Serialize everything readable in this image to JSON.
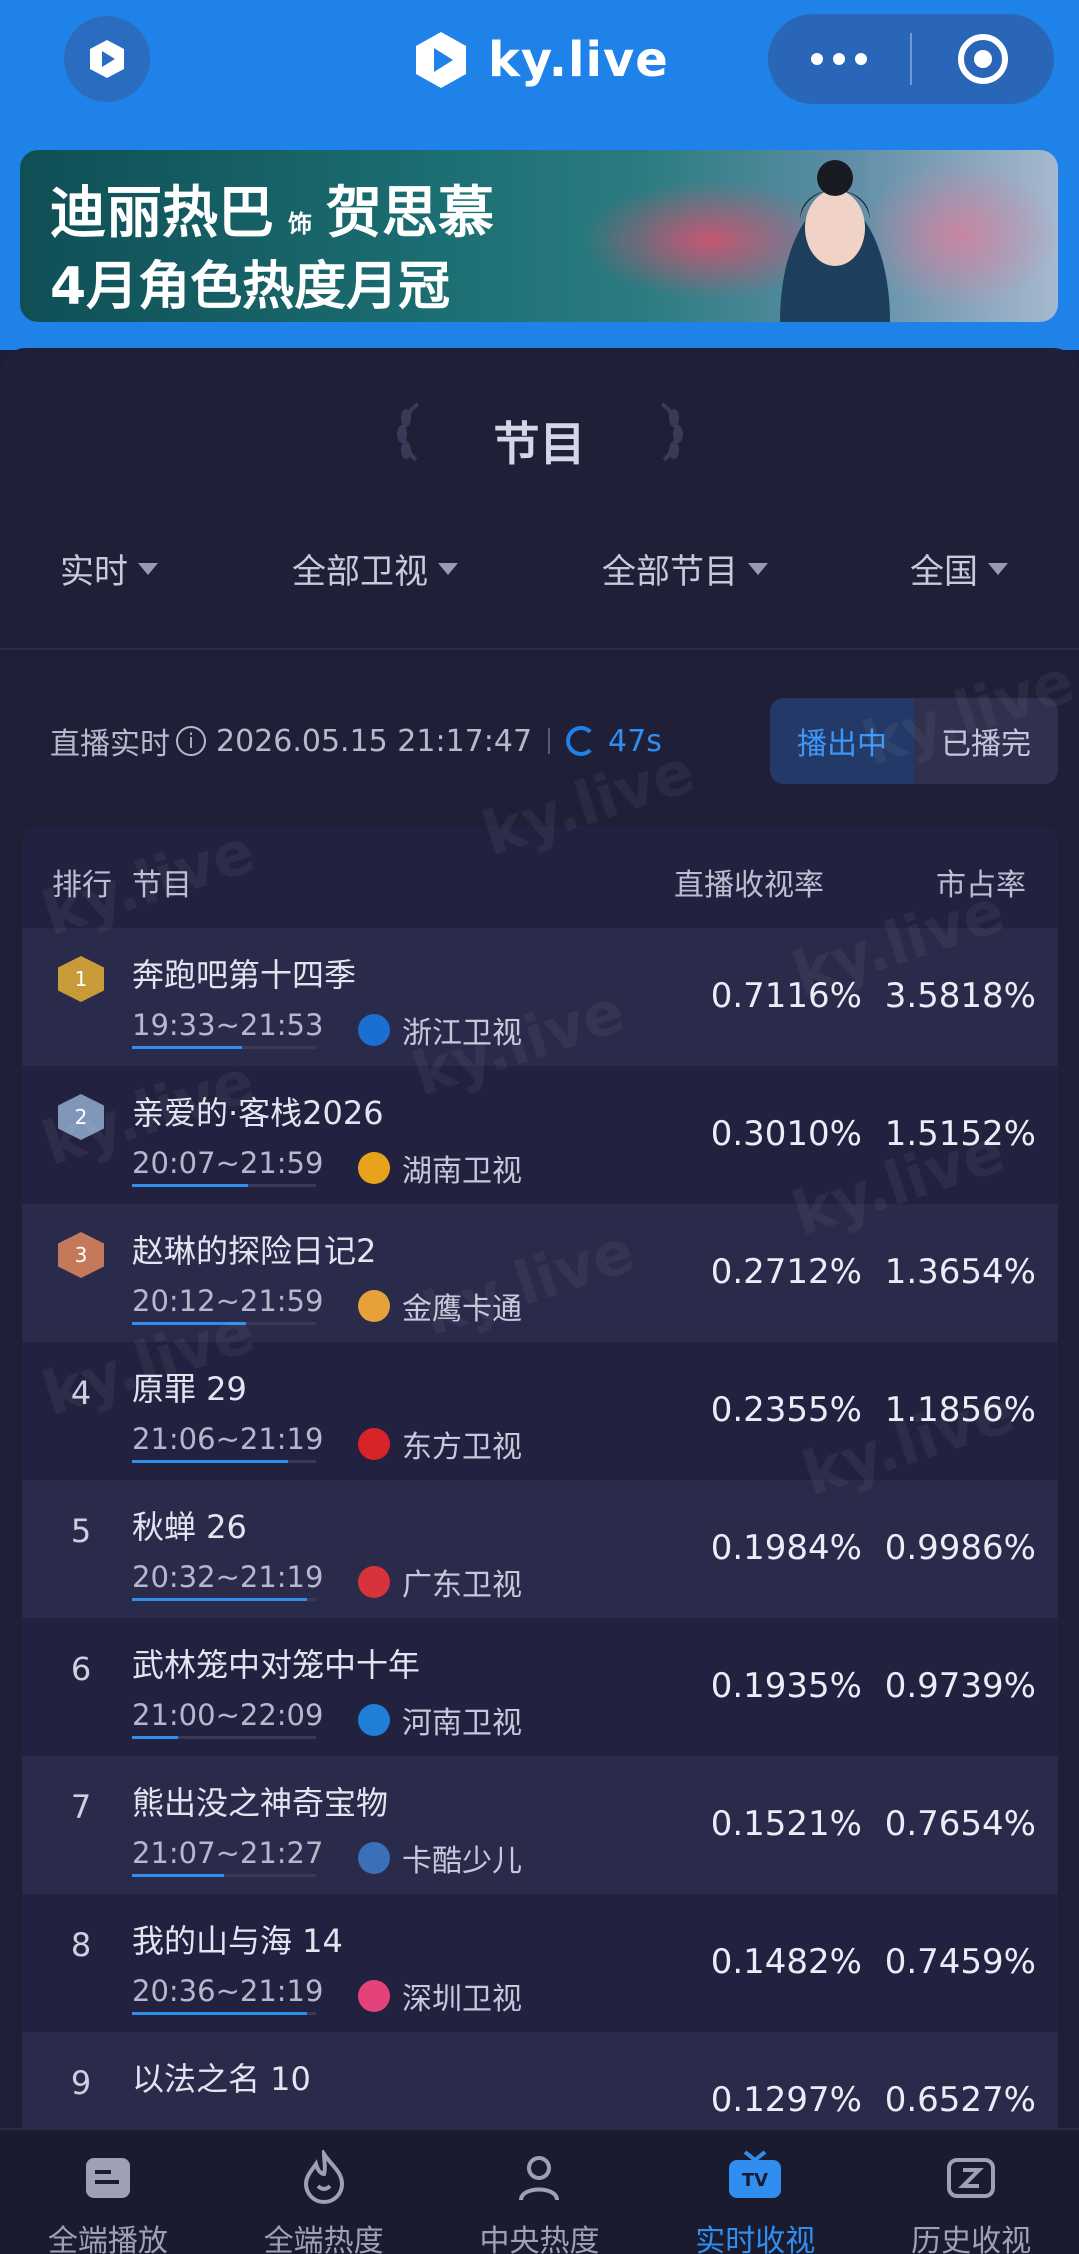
{
  "header": {
    "brand": "ky.live",
    "icons": {
      "app": "ky-logo-icon",
      "more": "more-dots-icon",
      "target": "target-icon"
    }
  },
  "banner": {
    "line1_a": "迪丽热巴",
    "line1_small": "饰",
    "line1_b": "贺思慕",
    "line2": "4月角色热度月冠"
  },
  "section_title": "节目",
  "filters": [
    {
      "label": "实时"
    },
    {
      "label": "全部卫视"
    },
    {
      "label": "全部节目"
    },
    {
      "label": "全国"
    }
  ],
  "status": {
    "label": "直播实时",
    "datetime": "2026.05.15 21:17:47",
    "countdown": "47s"
  },
  "toggle": {
    "on_air": "播出中",
    "finished": "已播完",
    "selected": "播出中"
  },
  "table": {
    "headers": {
      "rank": "排行",
      "program": "节目",
      "rating": "直播收视率",
      "share": "市占率"
    },
    "rows": [
      {
        "rank": "1",
        "name": "奔跑吧第十四季",
        "time": "19:33~21:53",
        "channel": "浙江卫视",
        "rating": "0.7116%",
        "share": "3.5818%",
        "progress": 0.6,
        "logo_color": "#1a6fd1"
      },
      {
        "rank": "2",
        "name": "亲爱的·客栈2026",
        "time": "20:07~21:59",
        "channel": "湖南卫视",
        "rating": "0.3010%",
        "share": "1.5152%",
        "progress": 0.63,
        "logo_color": "#e9a21c"
      },
      {
        "rank": "3",
        "name": "赵琳的探险日记2",
        "time": "20:12~21:59",
        "channel": "金鹰卡通",
        "rating": "0.2712%",
        "share": "1.3654%",
        "progress": 0.62,
        "logo_color": "#e6a23a"
      },
      {
        "rank": "4",
        "name": "原罪 29",
        "time": "21:06~21:19",
        "channel": "东方卫视",
        "rating": "0.2355%",
        "share": "1.1856%",
        "progress": 0.85,
        "logo_color": "#d8232a"
      },
      {
        "rank": "5",
        "name": "秋蝉 26",
        "time": "20:32~21:19",
        "channel": "广东卫视",
        "rating": "0.1984%",
        "share": "0.9986%",
        "progress": 0.95,
        "logo_color": "#d8333a"
      },
      {
        "rank": "6",
        "name": "武林笼中对笼中十年",
        "time": "21:00~22:09",
        "channel": "河南卫视",
        "rating": "0.1935%",
        "share": "0.9739%",
        "progress": 0.25,
        "logo_color": "#1e7fd6"
      },
      {
        "rank": "7",
        "name": "熊出没之神奇宝物",
        "time": "21:07~21:27",
        "channel": "卡酷少儿",
        "rating": "0.1521%",
        "share": "0.7654%",
        "progress": 0.5,
        "logo_color": "#3b6fb8"
      },
      {
        "rank": "8",
        "name": "我的山与海 14",
        "time": "20:36~21:19",
        "channel": "深圳卫视",
        "rating": "0.1482%",
        "share": "0.7459%",
        "progress": 0.95,
        "logo_color": "#e4427a"
      },
      {
        "rank": "9",
        "name": "以法之名 10",
        "time": "",
        "channel": "",
        "rating": "0.1297%",
        "share": "0.6527%",
        "progress": 0,
        "logo_color": "#2f8ef0"
      }
    ]
  },
  "tabbar": {
    "tabs": [
      {
        "label": "全端播放",
        "icon": "broadcast-icon"
      },
      {
        "label": "全端热度",
        "icon": "flame-icon"
      },
      {
        "label": "中央热度",
        "icon": "person-icon"
      },
      {
        "label": "实时收视",
        "icon": "tv-icon"
      },
      {
        "label": "历史收视",
        "icon": "history-icon"
      }
    ],
    "active": "实时收视"
  }
}
